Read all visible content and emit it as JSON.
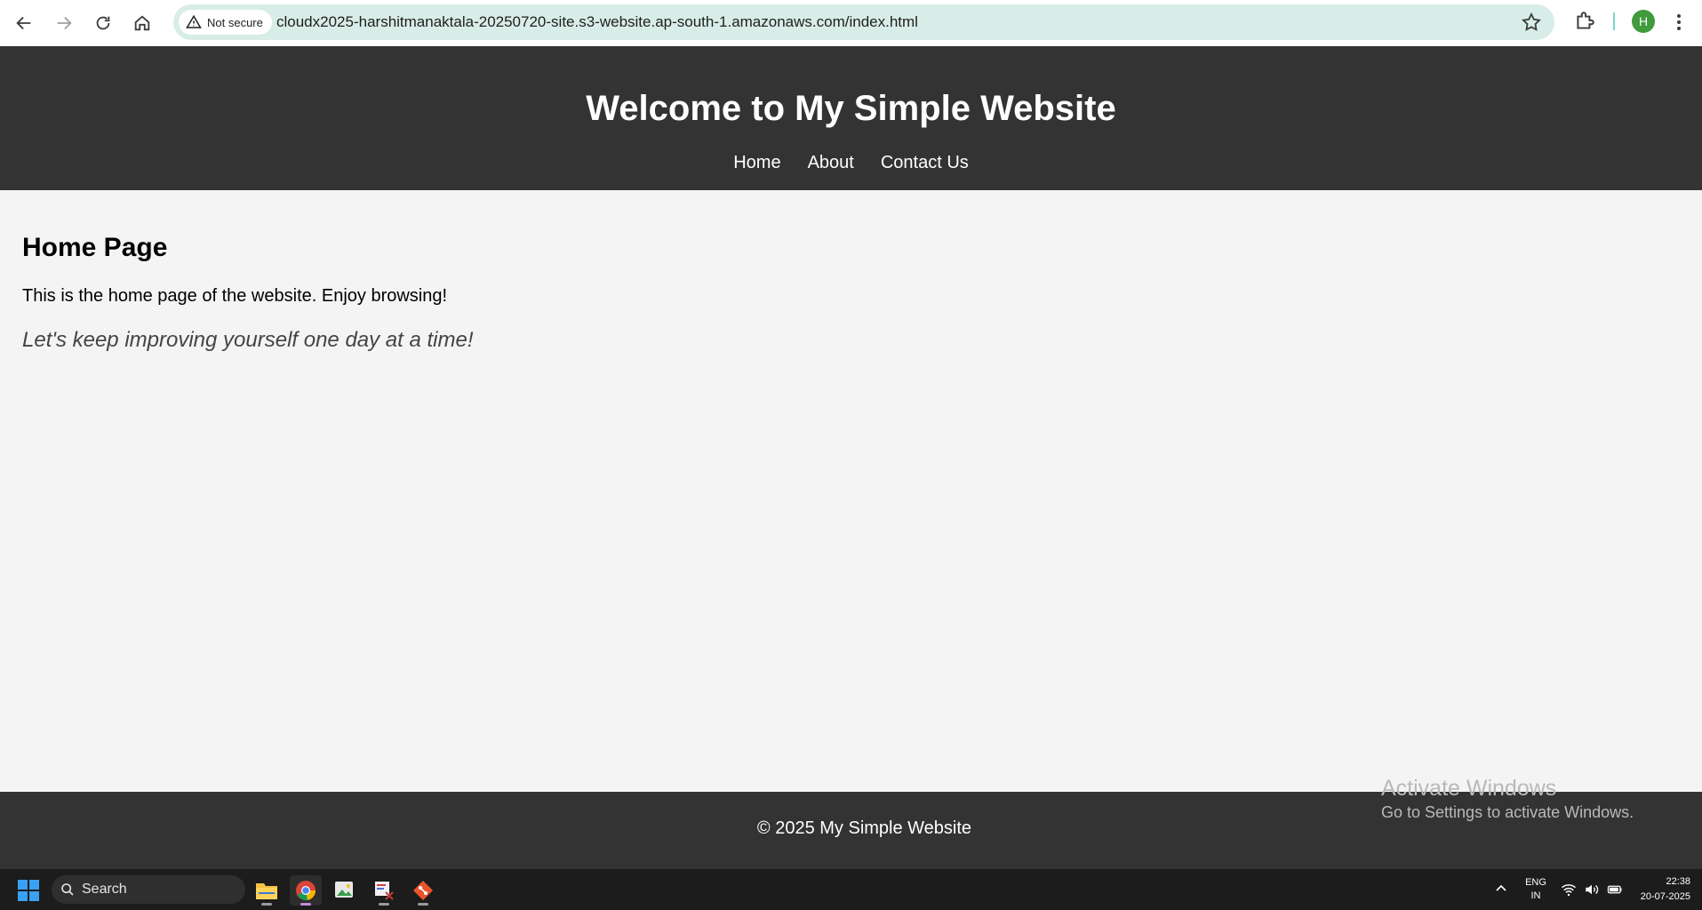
{
  "browser": {
    "security_chip": "Not secure",
    "url": "cloudx2025-harshitmanaktala-20250720-site.s3-website.ap-south-1.amazonaws.com/index.html",
    "profile_initial": "H",
    "icons": [
      "back-icon",
      "forward-icon",
      "reload-icon",
      "home-icon",
      "warning-icon",
      "star-icon",
      "extensions-icon",
      "more-icon"
    ]
  },
  "site": {
    "title": "Welcome to My Simple Website",
    "nav": [
      "Home",
      "About",
      "Contact Us"
    ],
    "main": {
      "heading": "Home Page",
      "intro": "This is the home page of the website. Enjoy browsing!",
      "quote": "Let's keep improving yourself one day at a time!"
    },
    "footer": "© 2025 My Simple Website"
  },
  "watermark": {
    "line1": "Activate Windows",
    "line2": "Go to Settings to activate Windows."
  },
  "taskbar": {
    "search_label": "Search",
    "apps": [
      "file-explorer-icon",
      "chrome-icon",
      "photos-app-icon",
      "snipping-tool-icon",
      "git-icon"
    ],
    "language": [
      "ENG",
      "IN"
    ],
    "time": "22:38",
    "date": "20-07-2025"
  },
  "colors": {
    "header_bg": "#333333",
    "page_bg": "#f4f4f4",
    "omnibox_bg": "#d8ede7",
    "taskbar_bg": "#1c1c1c"
  }
}
